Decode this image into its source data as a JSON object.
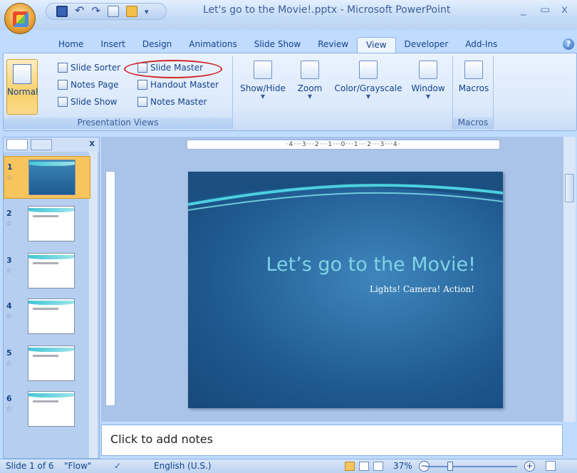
{
  "window": {
    "title": "Let's go to the Movie!.pptx - Microsoft PowerPoint",
    "minimize": "_",
    "maximize": "▭",
    "close": "x"
  },
  "tabs": [
    "Home",
    "Insert",
    "Design",
    "Animations",
    "Slide Show",
    "Review",
    "View",
    "Developer",
    "Add-Ins"
  ],
  "active_tab": "View",
  "ribbon": {
    "presentation_views": {
      "label": "Presentation Views",
      "normal": "Normal",
      "slide_sorter": "Slide Sorter",
      "notes_page": "Notes Page",
      "slide_show": "Slide Show",
      "slide_master": "Slide Master",
      "handout_master": "Handout Master",
      "notes_master": "Notes Master"
    },
    "show_hide": "Show/Hide",
    "zoom": "Zoom",
    "color_grayscale": "Color/Grayscale",
    "window": "Window",
    "macros": {
      "button": "Macros",
      "label": "Macros"
    }
  },
  "thumbnails": [
    {
      "num": "1"
    },
    {
      "num": "2"
    },
    {
      "num": "3"
    },
    {
      "num": "4"
    },
    {
      "num": "5"
    },
    {
      "num": "6"
    }
  ],
  "ruler_text": "·4···3···2···1···0···1···2···3···4·",
  "slide": {
    "title": "Let’s go to the Movie!",
    "subtitle": "Lights! Camera! Action!"
  },
  "notes_placeholder": "Click to add notes",
  "status": {
    "slide_info": "Slide 1 of 6",
    "theme": "\"Flow\"",
    "language": "English (U.S.)",
    "zoom": "37%"
  }
}
